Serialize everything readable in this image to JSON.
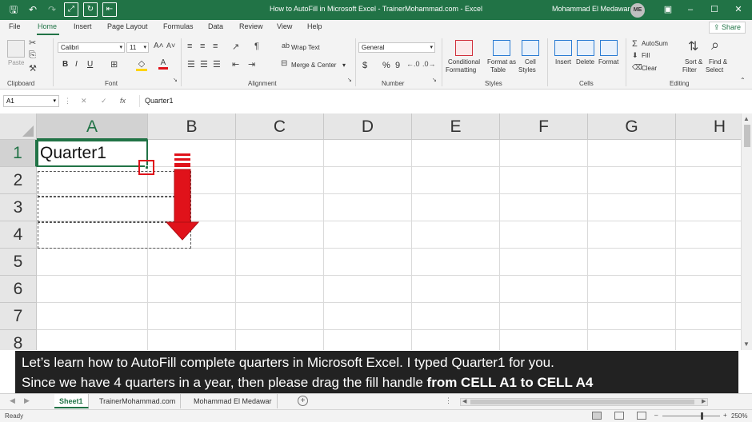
{
  "window": {
    "title": "How to AutoFill in Microsoft Excel - TrainerMohammad.com  -  Excel",
    "user_name": "Mohammad El Medawar",
    "user_initials": "ME"
  },
  "ribbon_tabs": [
    "File",
    "Home",
    "Insert",
    "Page Layout",
    "Formulas",
    "Data",
    "Review",
    "View",
    "Help"
  ],
  "share_label": "Share",
  "ribbon": {
    "clipboard": {
      "paste": "Paste",
      "label": "Clipboard"
    },
    "font": {
      "name": "Calibri",
      "size": "11",
      "bold": "B",
      "italic": "I",
      "underline": "U",
      "label": "Font"
    },
    "alignment": {
      "wrap_text": "Wrap Text",
      "merge_center": "Merge & Center",
      "label": "Alignment"
    },
    "number": {
      "format": "General",
      "currency": "$",
      "percent": "%",
      "comma": "9",
      "label": "Number"
    },
    "styles": {
      "conditional_1": "Conditional",
      "conditional_2": "Formatting",
      "format_table_1": "Format as",
      "format_table_2": "Table",
      "cell_styles_1": "Cell",
      "cell_styles_2": "Styles",
      "label": "Styles"
    },
    "cells": {
      "insert": "Insert",
      "delete": "Delete",
      "format": "Format",
      "label": "Cells"
    },
    "editing": {
      "autosum": "AutoSum",
      "fill": "Fill",
      "clear": "Clear",
      "sort_1": "Sort &",
      "sort_2": "Filter",
      "find_1": "Find &",
      "find_2": "Select",
      "label": "Editing"
    }
  },
  "formula_bar": {
    "name_box": "A1",
    "fx": "fx",
    "content": "Quarter1"
  },
  "grid": {
    "columns": [
      "A",
      "B",
      "C",
      "D",
      "E",
      "F",
      "G",
      "H"
    ],
    "rows": [
      "1",
      "2",
      "3",
      "4",
      "5",
      "6",
      "7",
      "8"
    ],
    "selected_column": "A",
    "selected_row": "1",
    "cell_a1": "Quarter1"
  },
  "caption": {
    "line1": "Let’s learn how to AutoFill complete quarters in Microsoft Excel. I typed Quarter1 for you.",
    "line2_plain": "Since we have 4 quarters in a year, then please drag the fill handle ",
    "line2_bold": "from CELL A1 to CELL A4"
  },
  "sheet_tabs": [
    "Sheet1",
    "TrainerMohammad.com",
    "Mohammad El Medawar"
  ],
  "active_sheet": "Sheet1",
  "add_sheet": "+",
  "status": {
    "ready": "Ready",
    "zoom": "250%"
  },
  "colors": {
    "excel_green": "#217346",
    "arrow_red": "#e0121a",
    "caption_bg": "#222222"
  }
}
